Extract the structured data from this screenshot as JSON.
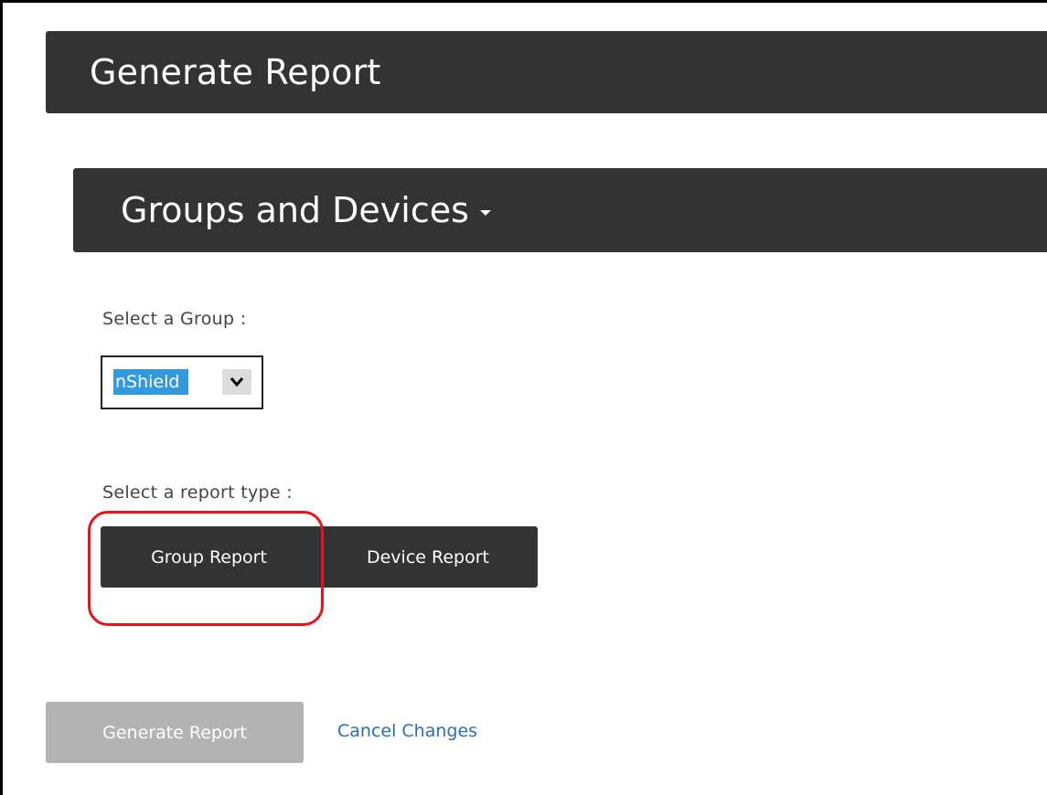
{
  "header": {
    "title": "Generate Report"
  },
  "section": {
    "title": "Groups and Devices",
    "caret_icon": "caret-down-icon"
  },
  "group_select": {
    "label": "Select a Group :",
    "selected_value": "nShield",
    "highlight_color": "#3399dd",
    "arrow_icon": "chevron-down-icon"
  },
  "report_type": {
    "label": "Select a report type :",
    "options": [
      "Group Report",
      "Device Report"
    ],
    "annotation_color": "#e8141c"
  },
  "actions": {
    "generate_label": "Generate Report",
    "cancel_label": "Cancel Changes"
  }
}
